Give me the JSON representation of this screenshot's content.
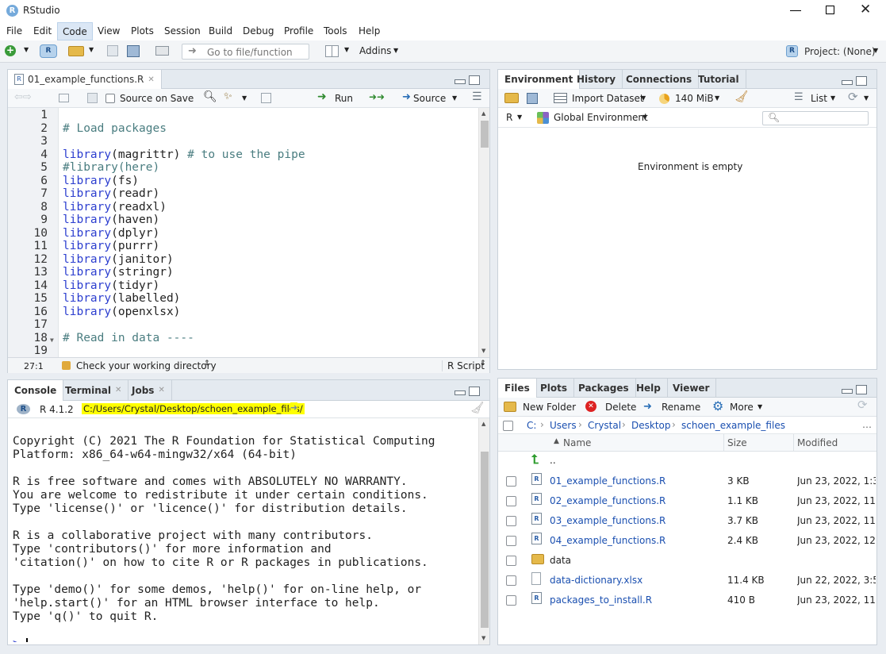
{
  "app": {
    "title": "RStudio",
    "menus": [
      "File",
      "Edit",
      "Code",
      "View",
      "Plots",
      "Session",
      "Build",
      "Debug",
      "Profile",
      "Tools",
      "Help"
    ],
    "goto_placeholder": "Go to file/function",
    "addins": "Addins",
    "project": "Project: (None)"
  },
  "source": {
    "tab": "01_example_functions.R",
    "source_on_save": "Source on Save",
    "run": "Run",
    "source_btn": "Source",
    "cursor_pos": "27:1",
    "scope": "Check your working directory",
    "file_type": "R Script",
    "lines": [
      {
        "n": "1",
        "t": []
      },
      {
        "n": "2",
        "t": [
          {
            "c": "cm",
            "s": "# Load packages"
          }
        ]
      },
      {
        "n": "3",
        "t": []
      },
      {
        "n": "4",
        "t": [
          {
            "c": "kw",
            "s": "library"
          },
          {
            "c": "",
            "s": "(magrittr) "
          },
          {
            "c": "cm",
            "s": "# to use the pipe"
          }
        ]
      },
      {
        "n": "5",
        "t": [
          {
            "c": "cm",
            "s": "#library(here)"
          }
        ]
      },
      {
        "n": "6",
        "t": [
          {
            "c": "kw",
            "s": "library"
          },
          {
            "c": "",
            "s": "(fs)"
          }
        ]
      },
      {
        "n": "7",
        "t": [
          {
            "c": "kw",
            "s": "library"
          },
          {
            "c": "",
            "s": "(readr)"
          }
        ]
      },
      {
        "n": "8",
        "t": [
          {
            "c": "kw",
            "s": "library"
          },
          {
            "c": "",
            "s": "(readxl)"
          }
        ]
      },
      {
        "n": "9",
        "t": [
          {
            "c": "kw",
            "s": "library"
          },
          {
            "c": "",
            "s": "(haven)"
          }
        ]
      },
      {
        "n": "10",
        "t": [
          {
            "c": "kw",
            "s": "library"
          },
          {
            "c": "",
            "s": "(dplyr)"
          }
        ]
      },
      {
        "n": "11",
        "t": [
          {
            "c": "kw",
            "s": "library"
          },
          {
            "c": "",
            "s": "(purrr)"
          }
        ]
      },
      {
        "n": "12",
        "t": [
          {
            "c": "kw",
            "s": "library"
          },
          {
            "c": "",
            "s": "(janitor)"
          }
        ]
      },
      {
        "n": "13",
        "t": [
          {
            "c": "kw",
            "s": "library"
          },
          {
            "c": "",
            "s": "(stringr)"
          }
        ]
      },
      {
        "n": "14",
        "t": [
          {
            "c": "kw",
            "s": "library"
          },
          {
            "c": "",
            "s": "(tidyr)"
          }
        ]
      },
      {
        "n": "15",
        "t": [
          {
            "c": "kw",
            "s": "library"
          },
          {
            "c": "",
            "s": "(labelled)"
          }
        ]
      },
      {
        "n": "16",
        "t": [
          {
            "c": "kw",
            "s": "library"
          },
          {
            "c": "",
            "s": "(openxlsx)"
          }
        ]
      },
      {
        "n": "17",
        "t": []
      },
      {
        "n": "18",
        "t": [
          {
            "c": "cm",
            "s": "# Read in data ----"
          }
        ]
      },
      {
        "n": "19",
        "t": []
      }
    ]
  },
  "console": {
    "tabs": [
      "Console",
      "Terminal",
      "Jobs"
    ],
    "r_version": "R 4.1.2",
    "path": "C:/Users/Crystal/Desktop/schoen_example_files/",
    "output": "Copyright (C) 2021 The R Foundation for Statistical Computing\nPlatform: x86_64-w64-mingw32/x64 (64-bit)\n\nR is free software and comes with ABSOLUTELY NO WARRANTY.\nYou are welcome to redistribute it under certain conditions.\nType 'license()' or 'licence()' for distribution details.\n\nR is a collaborative project with many contributors.\nType 'contributors()' for more information and\n'citation()' on how to cite R or R packages in publications.\n\nType 'demo()' for some demos, 'help()' for on-line help, or\n'help.start()' for an HTML browser interface to help.\nType 'q()' to quit R.",
    "prompt": ">"
  },
  "env": {
    "tabs": [
      "Environment",
      "History",
      "Connections",
      "Tutorial"
    ],
    "import_dataset": "Import Dataset",
    "memory": "140 MiB",
    "list": "List",
    "r_label": "R",
    "global_env": "Global Environment",
    "empty_msg": "Environment is empty"
  },
  "files": {
    "tabs": [
      "Files",
      "Plots",
      "Packages",
      "Help",
      "Viewer"
    ],
    "new_folder": "New Folder",
    "delete": "Delete",
    "rename": "Rename",
    "more": "More",
    "breadcrumb": [
      "C:",
      "Users",
      "Crystal",
      "Desktop",
      "schoen_example_files"
    ],
    "col_name": "Name",
    "col_size": "Size",
    "col_modified": "Modified",
    "parent": "..",
    "rows": [
      {
        "name": "01_example_functions.R",
        "size": "3 KB",
        "modified": "Jun 23, 2022, 1:3",
        "icon": "r-file"
      },
      {
        "name": "02_example_functions.R",
        "size": "1.1 KB",
        "modified": "Jun 23, 2022, 11:",
        "icon": "r-file"
      },
      {
        "name": "03_example_functions.R",
        "size": "3.7 KB",
        "modified": "Jun 23, 2022, 11:",
        "icon": "r-file"
      },
      {
        "name": "04_example_functions.R",
        "size": "2.4 KB",
        "modified": "Jun 23, 2022, 12:",
        "icon": "r-file"
      },
      {
        "name": "data",
        "size": "",
        "modified": "",
        "icon": "folder"
      },
      {
        "name": "data-dictionary.xlsx",
        "size": "11.4 KB",
        "modified": "Jun 22, 2022, 3:5",
        "icon": "doc"
      },
      {
        "name": "packages_to_install.R",
        "size": "410 B",
        "modified": "Jun 23, 2022, 11:",
        "icon": "r-file"
      }
    ]
  },
  "colors": {
    "accent": "#1a4fb0",
    "highlight": "#ffff00",
    "comment": "#4a7d80",
    "keyword": "#2c3ecf"
  }
}
